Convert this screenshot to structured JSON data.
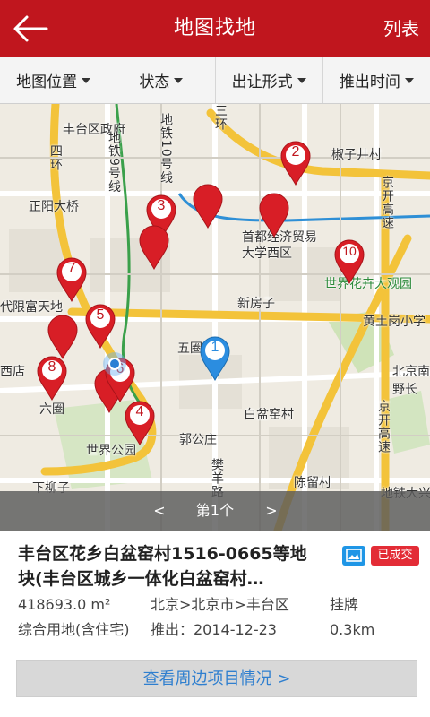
{
  "header": {
    "title": "地图找地",
    "right_label": "列表"
  },
  "filters": [
    {
      "label": "地图位置"
    },
    {
      "label": "状态"
    },
    {
      "label": "出让形式"
    },
    {
      "label": "推出时间"
    }
  ],
  "map": {
    "labels": {
      "fengtai_gov": "丰台区政府",
      "zhengyang_bridge": "正阳大桥",
      "si_huan": "四环",
      "sanhuan": "三环",
      "ditie_10": "地铁10号线",
      "ditie_9": "地铁9号线",
      "shoudu_univ": "首都经济贸易大学西区",
      "xinfangzi": "新房子",
      "huangtugang": "黄土岗小学",
      "shijie_huahui": "世界花卉大观园",
      "wuquan": "五圈",
      "daiyu_fuland": "代限富天地",
      "xiwangdian": "西店",
      "liuquan": "六圈",
      "guogongzhuang": "郭公庄",
      "baipenyao": "白盆窑村",
      "shijie_park": "世界公园",
      "xiazhuangzi": "下柳子",
      "chenliucun": "陈留村",
      "jingkai": "京开高速",
      "jingkai2": "京开高速",
      "jiaozhuang": "椒子井村",
      "beijing_nan": "北京南",
      "lanxian": "野长",
      "ditie_daxing": "地铁大兴",
      "zhuangyang": "樊羊路"
    },
    "markers": [
      "2",
      "3",
      "5",
      "7",
      "8",
      "6",
      "4",
      "10",
      "1"
    ]
  },
  "pager": {
    "prev": "<",
    "page": "第1个",
    "next": ">"
  },
  "item": {
    "title": "丰台区花乡白盆窑村1516-0665等地块(丰台区城乡一体化白盆窑村…",
    "badge_deal": "已成交",
    "area": "418693.0 m²",
    "location": "北京>北京市>丰台区",
    "status": "挂牌",
    "use": "综合用地(含住宅)",
    "date": "推出：2014-12-23",
    "distance": "0.3km",
    "action": "查看周边项目情况 >"
  }
}
